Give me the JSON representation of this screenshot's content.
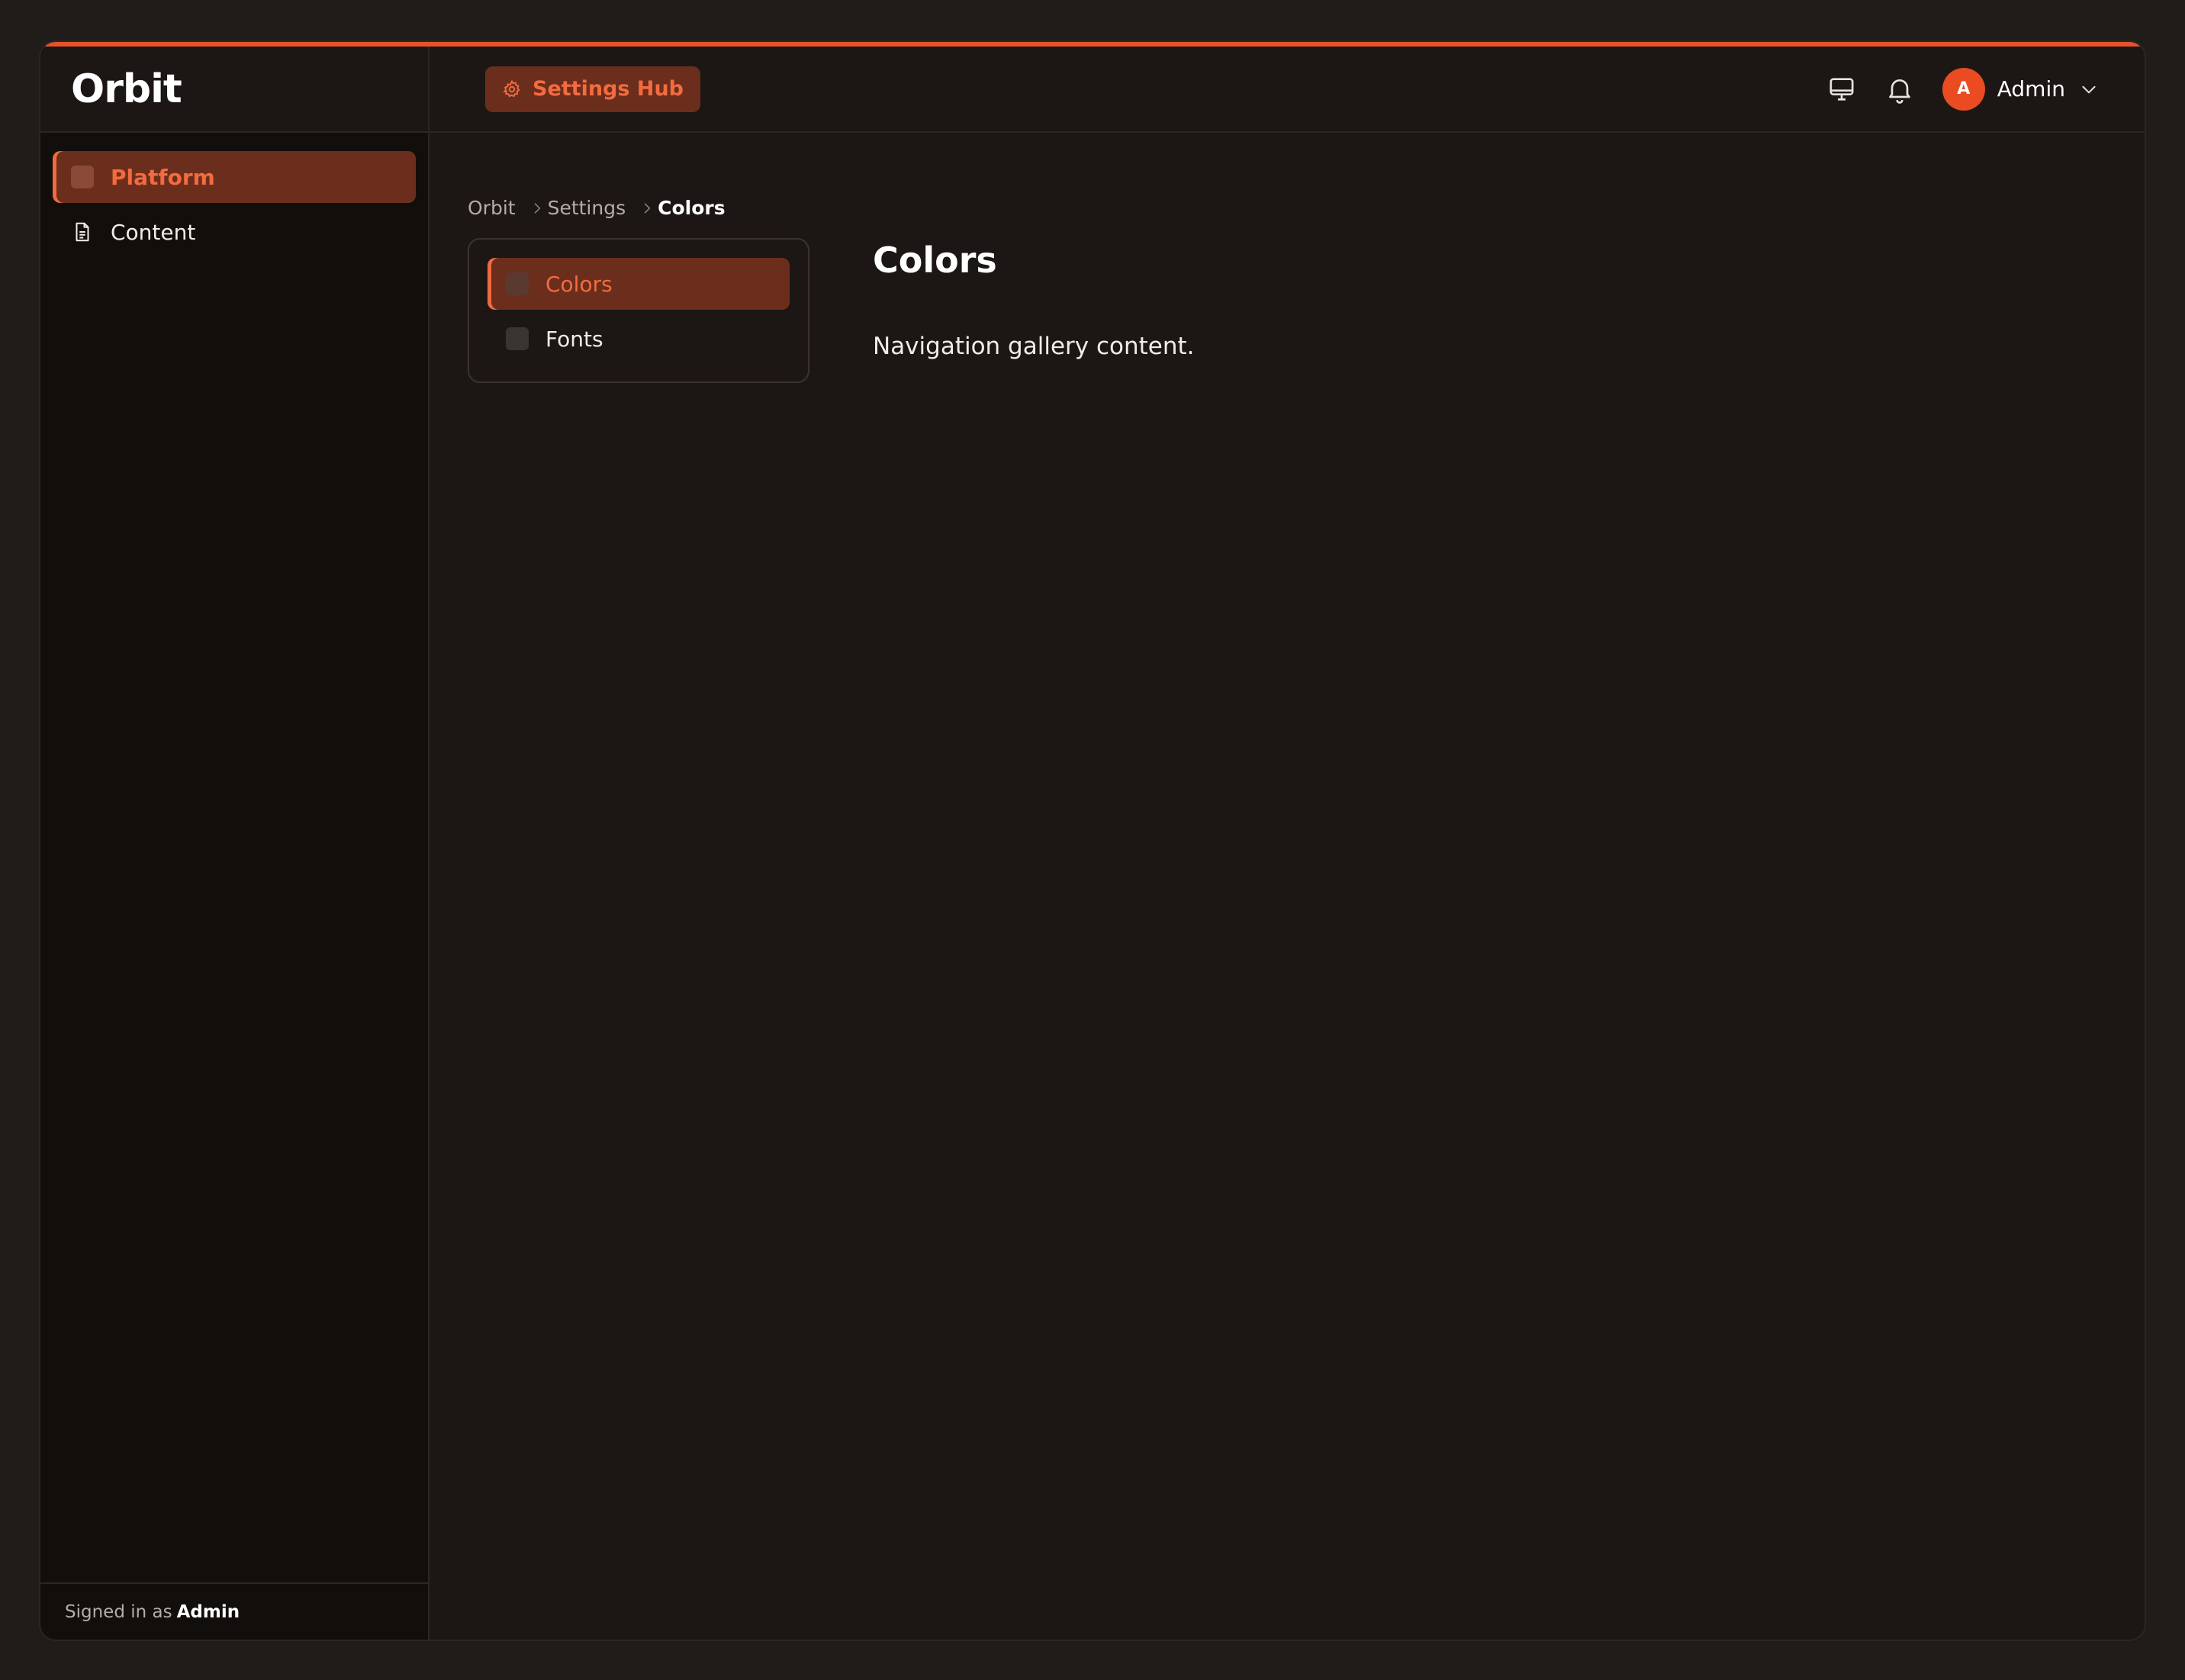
{
  "app": {
    "name": "Orbit"
  },
  "header": {
    "hub_label": "Settings Hub",
    "user": {
      "initial": "A",
      "name": "Admin"
    }
  },
  "sidebar": {
    "items": [
      {
        "label": "Platform",
        "active": true,
        "icon": "square-icon"
      },
      {
        "label": "Content",
        "active": false,
        "icon": "document-icon"
      }
    ],
    "footer_prefix": "Signed in as",
    "footer_user": "Admin"
  },
  "breadcrumb": [
    "Orbit",
    "Settings",
    "Colors"
  ],
  "subnav": {
    "items": [
      {
        "label": "Colors",
        "active": true
      },
      {
        "label": "Fonts",
        "active": false
      }
    ]
  },
  "content": {
    "title": "Colors",
    "body": "Navigation gallery content."
  },
  "colors": {
    "accent": "#e4532b",
    "active_bg": "#6b2e1d",
    "active_text": "#f36b3f",
    "background": "#1c1714"
  }
}
